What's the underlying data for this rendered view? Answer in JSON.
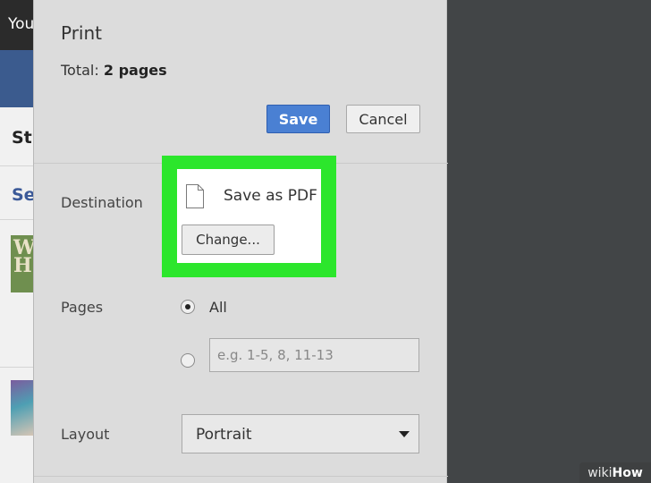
{
  "background_page": {
    "topbar_text": "You",
    "section_heading": "St",
    "link_text": "Se",
    "thumbnail_text": "W H"
  },
  "dialog": {
    "title": "Print",
    "total_label": "Total:",
    "total_value": "2 pages",
    "save_label": "Save",
    "cancel_label": "Cancel"
  },
  "destination": {
    "label": "Destination",
    "printer_name": "Save as PDF",
    "change_label": "Change...",
    "icon": "document-icon",
    "highlight_color": "#2ce62c"
  },
  "pages": {
    "label": "Pages",
    "option_all": "All",
    "selected": "All",
    "custom_placeholder": "e.g. 1-5, 8, 11-13"
  },
  "layout": {
    "label": "Layout",
    "selected": "Portrait"
  },
  "watermark": {
    "part1": "wiki",
    "part2": "How"
  },
  "colors": {
    "save_button": "#4a80d3",
    "preview_background": "#424547",
    "panel_background": "#dcdcdc"
  }
}
